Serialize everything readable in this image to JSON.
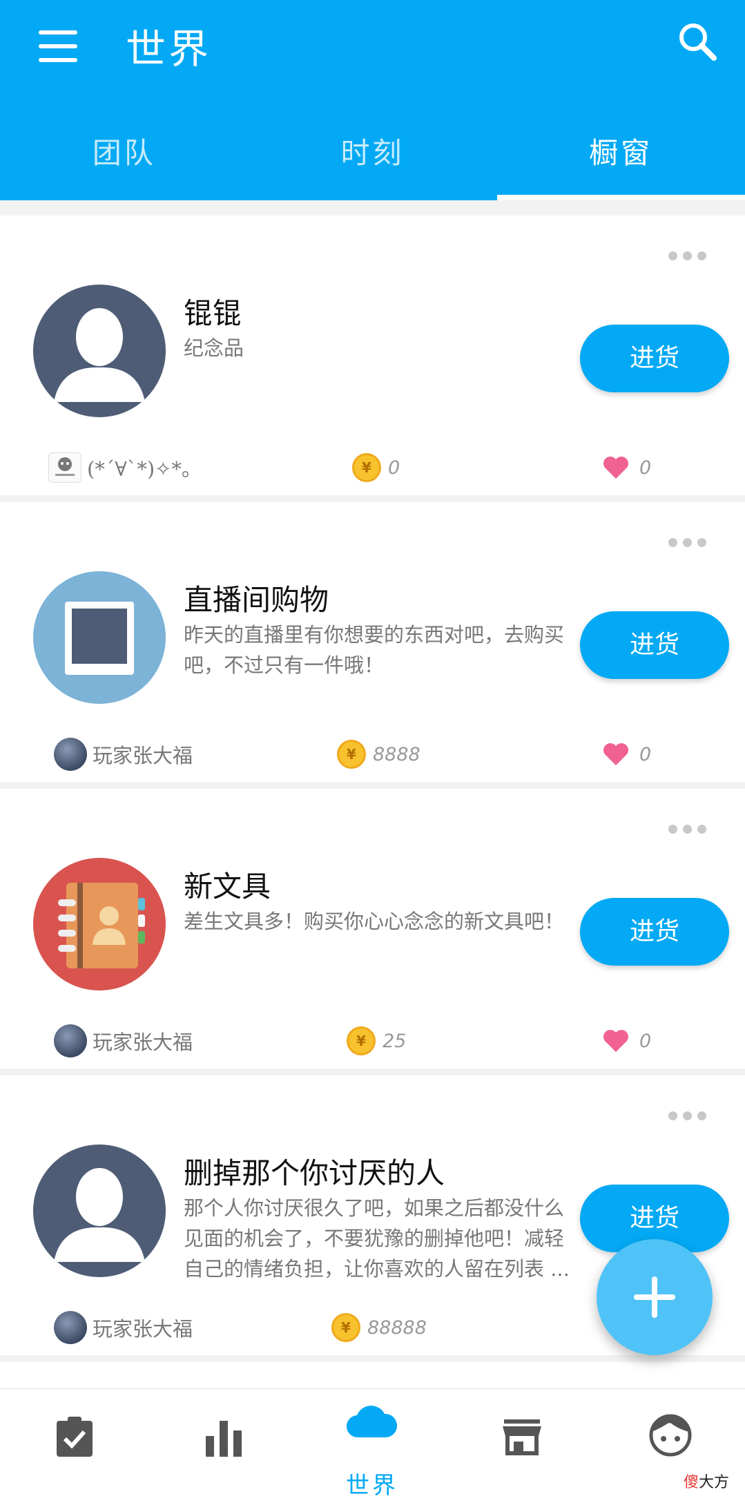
{
  "header": {
    "title": "世界",
    "tabs": [
      {
        "label": "团队",
        "active": false
      },
      {
        "label": "时刻",
        "active": false
      },
      {
        "label": "橱窗",
        "active": true
      }
    ]
  },
  "cards": [
    {
      "title": "锟锟",
      "description": "纪念品",
      "icon": "default-user-avatar-icon",
      "button_label": "进货",
      "author_name": "(*´∀`*)✧*。",
      "price": "0",
      "likes": "0"
    },
    {
      "title": "直播间购物",
      "description": "昨天的直播里有你想要的东西对吧，去购买吧，不过只有一件哦！",
      "icon": "picture-frame-icon",
      "button_label": "进货",
      "author_name": "玩家张大福",
      "price": "8888",
      "likes": "0"
    },
    {
      "title": "新文具",
      "description": "差生文具多！购买你心心念念的新文具吧！",
      "icon": "address-book-icon",
      "button_label": "进货",
      "author_name": "玩家张大福",
      "price": "25",
      "likes": "0"
    },
    {
      "title": "删掉那个你讨厌的人",
      "description": "那个人你讨厌很久了吧，如果之后都没什么见面的机会了，不要犹豫的删掉他吧！减轻自己的情绪负担，让你喜欢的人留在列表 ...",
      "icon": "default-user-avatar-icon",
      "button_label": "进货",
      "author_name": "玩家张大福",
      "price": "88888",
      "likes": ""
    }
  ],
  "bottom_nav": {
    "items": [
      {
        "icon": "clipboard-check-icon",
        "label": ""
      },
      {
        "icon": "bar-chart-icon",
        "label": ""
      },
      {
        "icon": "cloud-icon",
        "label": "世界"
      },
      {
        "icon": "store-icon",
        "label": ""
      },
      {
        "icon": "face-icon",
        "label": ""
      }
    ],
    "active_index": 2
  },
  "watermark": {
    "part1": "傻",
    "part2": "大方"
  },
  "colors": {
    "primary": "#03a9f4",
    "fab": "#4fc3f7",
    "heart": "#f06292",
    "coin": "#f7c22d"
  }
}
